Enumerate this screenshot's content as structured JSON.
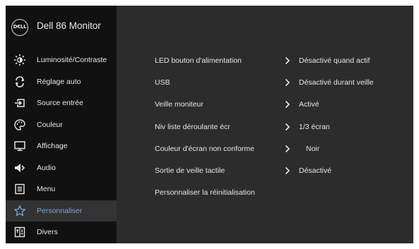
{
  "brand": {
    "logo_text": "DELL",
    "model": "Dell 86 Monitor"
  },
  "sidebar": {
    "items": [
      {
        "label": "Luminosité/Contraste",
        "icon": "brightness-icon",
        "selected": false
      },
      {
        "label": "Réglage auto",
        "icon": "auto-adjust-icon",
        "selected": false
      },
      {
        "label": "Source entrée",
        "icon": "input-source-icon",
        "selected": false
      },
      {
        "label": "Couleur",
        "icon": "color-palette-icon",
        "selected": false
      },
      {
        "label": "Affichage",
        "icon": "display-icon",
        "selected": false
      },
      {
        "label": "Audio",
        "icon": "speaker-icon",
        "selected": false
      },
      {
        "label": "Menu",
        "icon": "menu-list-icon",
        "selected": false
      },
      {
        "label": "Personnaliser",
        "icon": "star-icon",
        "selected": true
      },
      {
        "label": "Divers",
        "icon": "misc-icon",
        "selected": false
      }
    ]
  },
  "settings": {
    "rows": [
      {
        "label": "LED bouton d'alimentation",
        "value": "Désactivé quand actif",
        "has_submenu": true
      },
      {
        "label": "USB",
        "value": "Désactivé durant veille",
        "has_submenu": true
      },
      {
        "label": "Veille moniteur",
        "value": "Activé",
        "has_submenu": true
      },
      {
        "label": "Niv liste déroulante écr",
        "value": "1/3 écran",
        "has_submenu": true
      },
      {
        "label": "Couleur d'écran non conforme",
        "value": "Noir",
        "has_submenu": true
      },
      {
        "label": "Sortie de veille tactile",
        "value": "Désactivé",
        "has_submenu": true
      },
      {
        "label": "Personnaliser la réinitialisation",
        "value": "",
        "has_submenu": false
      }
    ]
  },
  "colors": {
    "sidebar_bg": "#111111",
    "panel_bg": "#2c2c2c",
    "selected_bg": "#333333",
    "selected_text": "#7aa8d8",
    "text": "#e6e6e6"
  }
}
